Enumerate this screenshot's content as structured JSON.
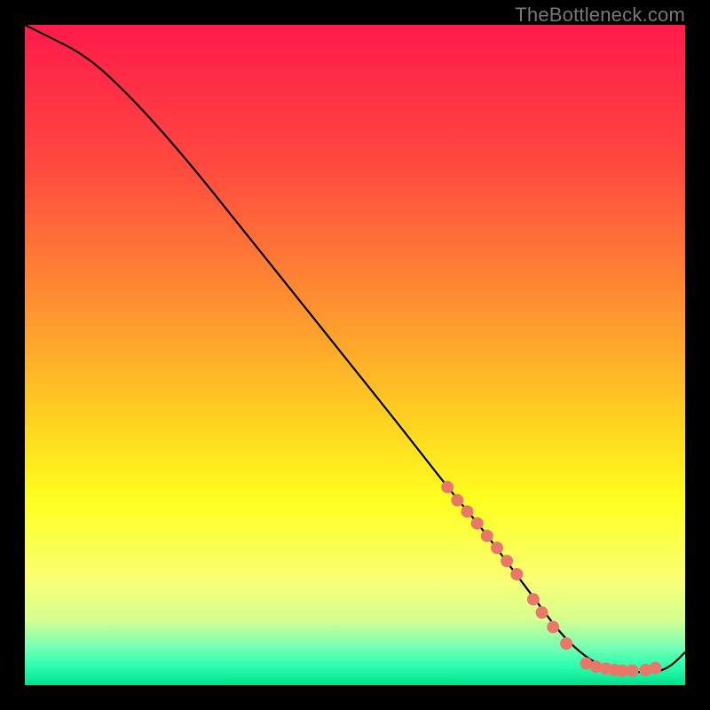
{
  "watermark": "TheBottleneck.com",
  "chart_data": {
    "type": "line",
    "title": "",
    "xlabel": "",
    "ylabel": "",
    "xlim": [
      0,
      100
    ],
    "ylim": [
      0,
      100
    ],
    "grid": false,
    "legend": false,
    "gradient_stops": [
      {
        "offset": 0,
        "color": "#ff1a4b"
      },
      {
        "offset": 22,
        "color": "#ff4b3f"
      },
      {
        "offset": 45,
        "color": "#ff9a2f"
      },
      {
        "offset": 60,
        "color": "#ffd21f"
      },
      {
        "offset": 72,
        "color": "#ffff1f"
      },
      {
        "offset": 84,
        "color": "#faff74"
      },
      {
        "offset": 90,
        "color": "#d6ff8f"
      },
      {
        "offset": 94,
        "color": "#7dffb4"
      },
      {
        "offset": 97,
        "color": "#2dffb0"
      },
      {
        "offset": 100,
        "color": "#05e08c"
      }
    ],
    "series": [
      {
        "name": "bottleneck-curve",
        "color": "#000000",
        "x": [
          0,
          4,
          8,
          12,
          18,
          25,
          33,
          41,
          49,
          57,
          64,
          69,
          72,
          75,
          78,
          81,
          84,
          87,
          90,
          93,
          96,
          98,
          100
        ],
        "y": [
          100,
          98,
          96,
          93,
          87,
          79,
          69,
          59,
          49,
          39,
          30,
          24,
          20,
          16,
          12,
          8,
          5,
          3,
          2,
          2,
          2,
          3,
          5
        ]
      }
    ],
    "markers": {
      "name": "highlight-points",
      "color": "#e9786b",
      "radius": 7,
      "points": [
        {
          "x": 64,
          "y": 30
        },
        {
          "x": 65.5,
          "y": 28
        },
        {
          "x": 67,
          "y": 26.3
        },
        {
          "x": 68.5,
          "y": 24.5
        },
        {
          "x": 70,
          "y": 22.6
        },
        {
          "x": 71.5,
          "y": 20.8
        },
        {
          "x": 73,
          "y": 18.8
        },
        {
          "x": 74.5,
          "y": 16.8
        },
        {
          "x": 77,
          "y": 13
        },
        {
          "x": 78.3,
          "y": 11
        },
        {
          "x": 80,
          "y": 8.8
        },
        {
          "x": 82,
          "y": 6.3
        },
        {
          "x": 85,
          "y": 3.3
        },
        {
          "x": 86.5,
          "y": 2.8
        },
        {
          "x": 88,
          "y": 2.5
        },
        {
          "x": 89.3,
          "y": 2.3
        },
        {
          "x": 90.5,
          "y": 2.2
        },
        {
          "x": 92,
          "y": 2.2
        },
        {
          "x": 94,
          "y": 2.3
        },
        {
          "x": 95.5,
          "y": 2.6
        }
      ]
    }
  }
}
